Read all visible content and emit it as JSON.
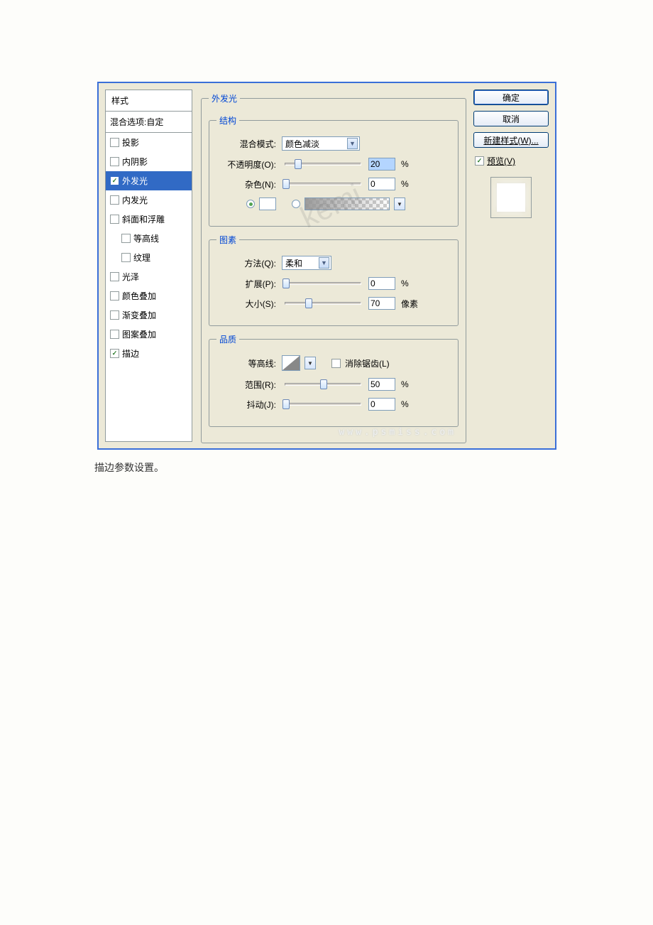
{
  "styles_panel": {
    "header": "样式",
    "blending_options": "混合选项:自定",
    "items": [
      {
        "label": "投影",
        "checked": false
      },
      {
        "label": "内阴影",
        "checked": false
      },
      {
        "label": "外发光",
        "checked": true,
        "selected": true
      },
      {
        "label": "内发光",
        "checked": false
      },
      {
        "label": "斜面和浮雕",
        "checked": false
      },
      {
        "label": "等高线",
        "checked": false,
        "indent": true
      },
      {
        "label": "纹理",
        "checked": false,
        "indent": true
      },
      {
        "label": "光泽",
        "checked": false
      },
      {
        "label": "颜色叠加",
        "checked": false
      },
      {
        "label": "渐变叠加",
        "checked": false
      },
      {
        "label": "图案叠加",
        "checked": false
      },
      {
        "label": "描边",
        "checked": true
      }
    ]
  },
  "center": {
    "title": "外发光",
    "structure": {
      "legend": "结构",
      "blend_mode_label": "混合模式:",
      "blend_mode_value": "颜色减淡",
      "opacity_label": "不透明度(O):",
      "opacity_value": "20",
      "opacity_unit": "%",
      "noise_label": "杂色(N):",
      "noise_value": "0",
      "noise_unit": "%"
    },
    "elements": {
      "legend": "图素",
      "technique_label": "方法(Q):",
      "technique_value": "柔和",
      "spread_label": "扩展(P):",
      "spread_value": "0",
      "spread_unit": "%",
      "size_label": "大小(S):",
      "size_value": "70",
      "size_unit": "像素"
    },
    "quality": {
      "legend": "品质",
      "contour_label": "等高线:",
      "anti_alias_label": "消除锯齿(L)",
      "range_label": "范围(R):",
      "range_value": "50",
      "range_unit": "%",
      "jitter_label": "抖动(J):",
      "jitter_value": "0",
      "jitter_unit": "%"
    }
  },
  "buttons": {
    "ok": "确定",
    "cancel": "取消",
    "new_style": "新建样式(W)...",
    "preview": "预览(V)"
  },
  "caption": "描边参数设置。",
  "watermark": "kemi",
  "watermark_url": "www.psmiss.com"
}
